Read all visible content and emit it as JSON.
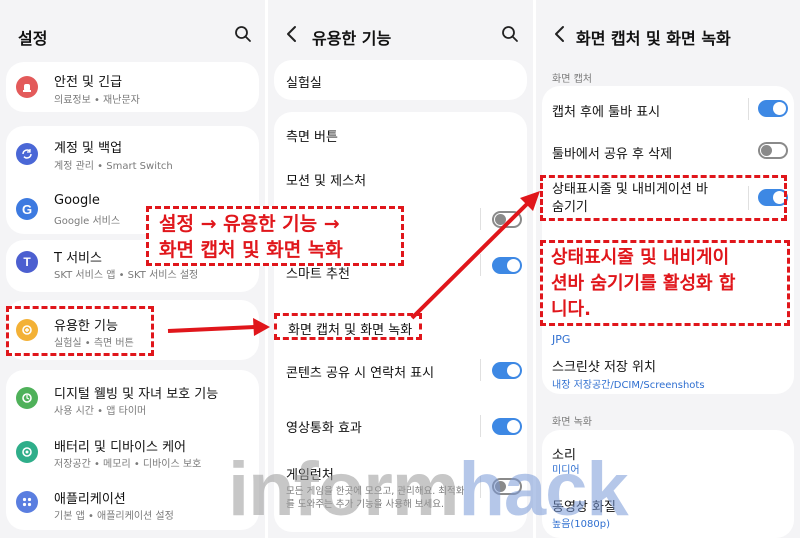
{
  "panel1": {
    "title": "설정",
    "items": [
      {
        "title": "안전 및 긴급",
        "sub": "의료정보 • 재난문자",
        "icon": "siren-icon",
        "color": "#e35a5a"
      },
      {
        "title": "계정 및 백업",
        "sub": "계정 관리 • Smart Switch",
        "icon": "sync-icon",
        "color": "#4a67d6"
      },
      {
        "title": "Google",
        "sub": "Google 서비스",
        "icon": "google-icon",
        "color": "#3d7ae0"
      },
      {
        "title": "T 서비스",
        "sub": "SKT 서비스 앱 • SKT 서비스 설정",
        "icon": "t-service-icon",
        "color": "#4c5fd0"
      },
      {
        "title": "유용한 기능",
        "sub": "실험실 • 측면 버튼",
        "icon": "gear-plus-icon",
        "color": "#f3b136"
      },
      {
        "title": "디지털 웰빙 및 자녀 보호 기능",
        "sub": "사용 시간 • 앱 타이머",
        "icon": "wellbeing-icon",
        "color": "#4fb15a"
      },
      {
        "title": "배터리 및 디바이스 케어",
        "sub": "저장공간 • 메모리 • 디바이스 보호",
        "icon": "device-care-icon",
        "color": "#2fae8a"
      },
      {
        "title": "애플리케이션",
        "sub": "기본 앱 • 애플리케이션 설정",
        "icon": "apps-icon",
        "color": "#5a7ee0"
      }
    ]
  },
  "panel2": {
    "title": "유용한 기능",
    "items": [
      {
        "title": "실험실"
      },
      {
        "title": "측면 버튼"
      },
      {
        "title": "모션 및 제스처"
      },
      {
        "title": "스마트 추천"
      },
      {
        "title": "화면 캡처 및 화면 녹화"
      },
      {
        "title": "콘텐츠 공유 시 연락처 표시"
      },
      {
        "title": "영상통화 효과"
      },
      {
        "title": "게임런처",
        "sub": "모든 게임을 한곳에 모으고, 관리해요. 최적화를 도와주는 추가 기능을 사용해 보세요."
      }
    ],
    "toggles": {
      "hidden_row": false,
      "smart_reco": true,
      "contact_share": true,
      "video_effect": true,
      "game_launcher": false
    }
  },
  "panel3": {
    "title": "화면 캡처 및 화면 녹화",
    "section_capture": "화면 캡처",
    "toolbar_label": "캡처 후에 툴바 표시",
    "delete_label": "툴바에서 공유 후 삭제",
    "hide_label": "상태표시줄 및 내비게이션 바 숨기기",
    "format_sub": "JPG",
    "location_label": "스크린샷 저장 위치",
    "location_sub": "내장 저장공간/DCIM/Screenshots",
    "section_record": "화면 녹화",
    "sound_label": "소리",
    "sound_sub": "미디어",
    "quality_label": "동영상 화질",
    "quality_sub": "높음(1080p)",
    "toggles": {
      "toolbar": true,
      "delete": false,
      "hide": true
    }
  },
  "annotations": {
    "path_line1": "설정 → 유용한 기능 →",
    "path_line2": "화면 캡처 및 화면 녹화",
    "note_line1": "상태표시줄 및 내비게이",
    "note_line2": "션바 숨기기를 활성화 합",
    "note_line3": "니다."
  },
  "watermark": {
    "part1": "inform",
    "part2": "hack"
  },
  "colors": {
    "accent": "#3d88e4",
    "annotation": "#e0161b",
    "background": "#f4f4f6"
  }
}
